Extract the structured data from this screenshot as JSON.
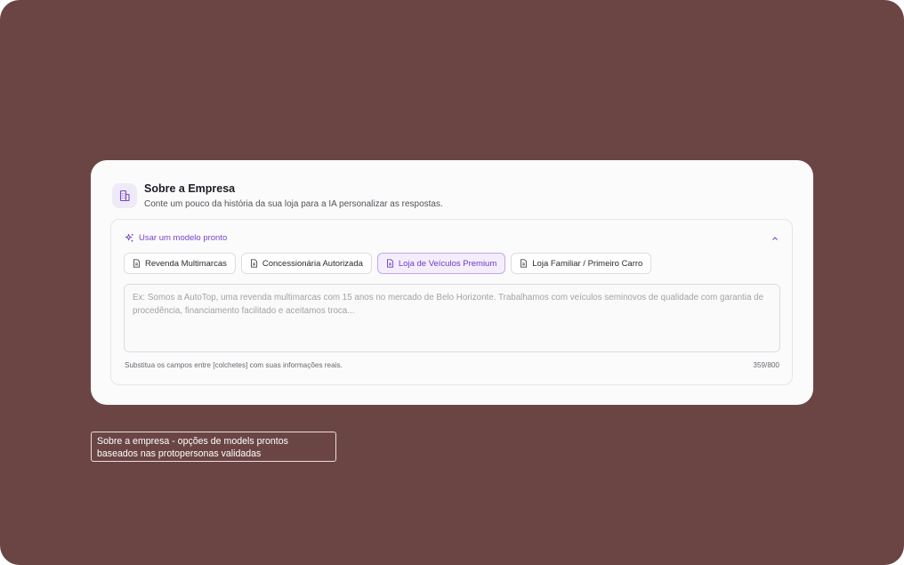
{
  "card": {
    "title": "Sobre a Empresa",
    "subtitle": "Conte um pouco da história da sua loja para a IA personalizar as respostas.",
    "icon": "building-icon"
  },
  "templates": {
    "toggle_label": "Usar um modelo pronto",
    "toggle_icon": "sparkle-icon",
    "expanded": true,
    "chips": [
      {
        "label": "Revenda Multimarcas",
        "icon": "document-icon",
        "active": false
      },
      {
        "label": "Concessionária Autorizada",
        "icon": "document-icon",
        "active": false
      },
      {
        "label": "Loja de Veículos Premium",
        "icon": "document-icon",
        "active": true
      },
      {
        "label": "Loja Familiar / Primeiro Carro",
        "icon": "document-icon",
        "active": false
      }
    ]
  },
  "description": {
    "placeholder": "Ex: Somos a AutoTop, uma revenda multimarcas com 15 anos no mercado de Belo Horizonte. Trabalhamos com veículos seminovos de qualidade com garantia de procedência, financiamento facilitado e aceitamos troca...",
    "helper_text": "Substitua os campos entre [colchetes] com suas informações reais.",
    "counter": "359/800"
  },
  "annotation": {
    "line1": "Sobre a empresa  - opções de models prontos",
    "line2": "baseados nas protopersonas validadas"
  },
  "colors": {
    "background": "#6b4544",
    "card": "#fbfbfb",
    "accent": "#7a44c9",
    "chip_active_bg": "#f4eefc"
  }
}
